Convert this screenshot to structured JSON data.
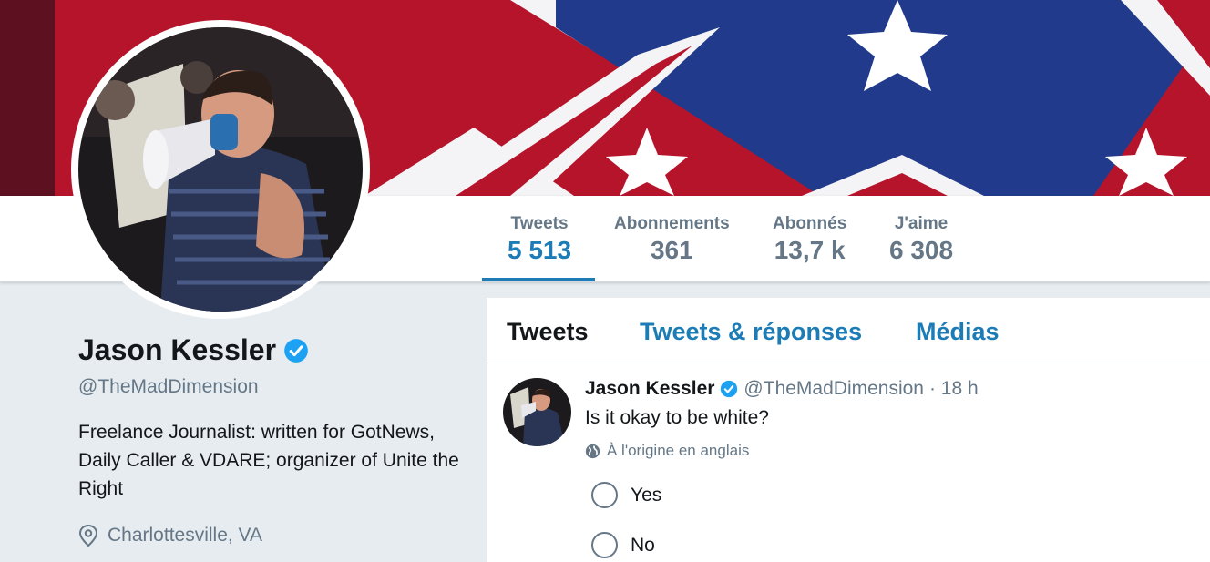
{
  "stats": [
    {
      "label": "Tweets",
      "value": "5 513"
    },
    {
      "label": "Abonnements",
      "value": "361"
    },
    {
      "label": "Abonnés",
      "value": "13,7 k"
    },
    {
      "label": "J'aime",
      "value": "6 308"
    }
  ],
  "profile": {
    "name": "Jason Kessler",
    "handle": "@TheMadDimension",
    "bio": "Freelance Journalist: written for GotNews, Daily Caller & VDARE; organizer of Unite the Right",
    "location": "Charlottesville, VA"
  },
  "tabs": [
    {
      "label": "Tweets"
    },
    {
      "label": "Tweets & réponses"
    },
    {
      "label": "Médias"
    }
  ],
  "tweet": {
    "name": "Jason Kessler",
    "handle": "@TheMadDimension",
    "time": "· 18 h",
    "text": "Is it okay to be white?",
    "translate": "À l'origine en anglais",
    "poll": [
      "Yes",
      "No"
    ]
  },
  "colors": {
    "accent": "#1d7cb5",
    "verified": "#1da1f2",
    "muted": "#657786",
    "page_bg": "#e6ecf0"
  }
}
